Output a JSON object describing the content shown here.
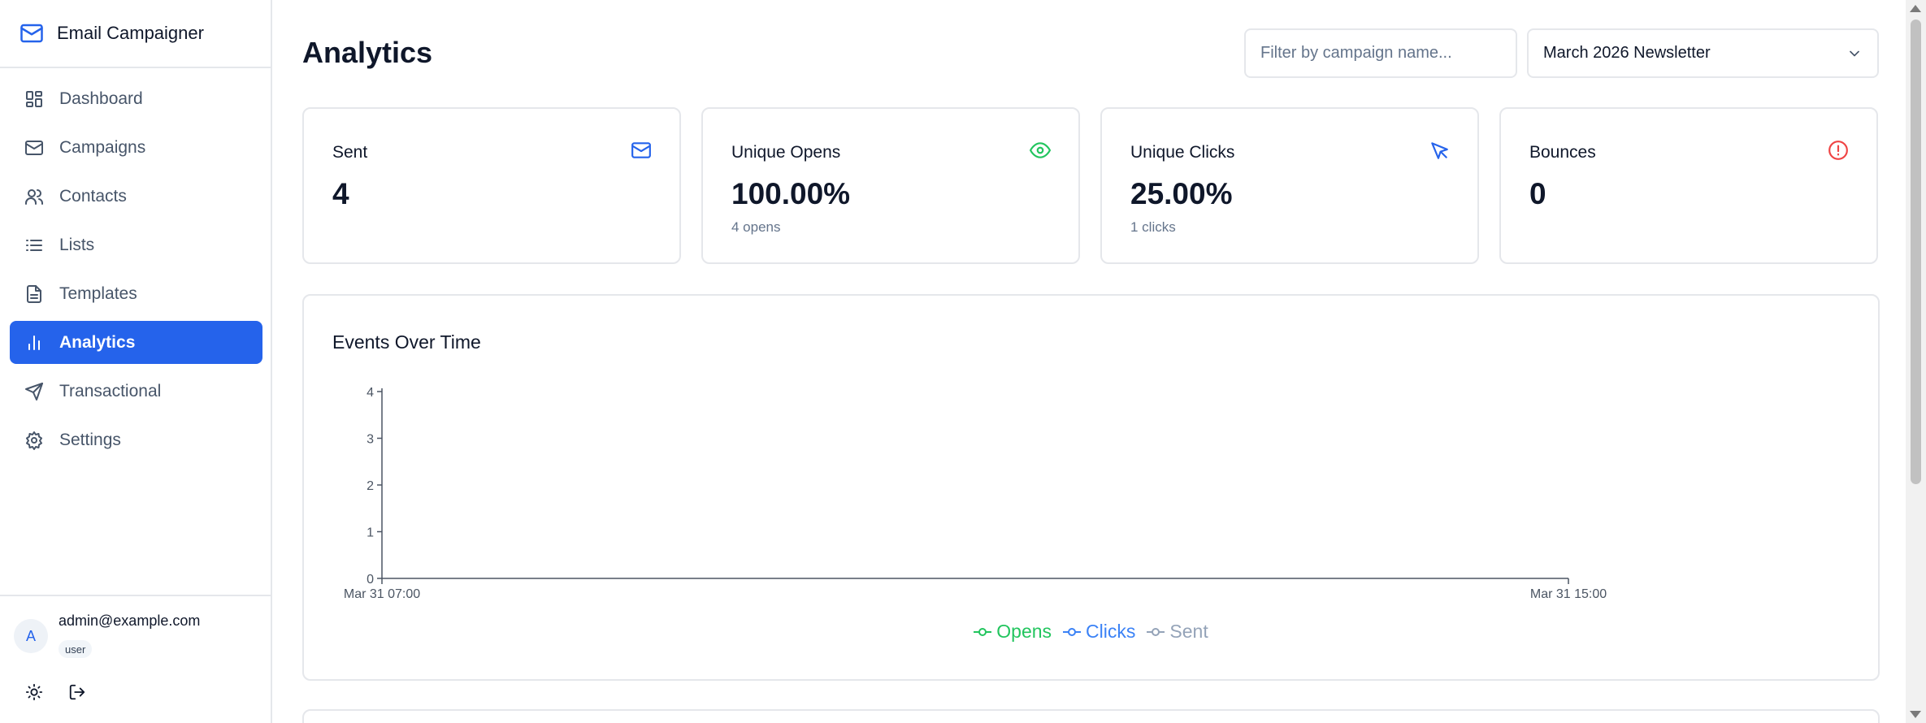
{
  "app": {
    "title": "Email Campaigner"
  },
  "sidebar": {
    "items": [
      {
        "label": "Dashboard",
        "icon": "dashboard-icon",
        "active": false
      },
      {
        "label": "Campaigns",
        "icon": "mail-icon",
        "active": false
      },
      {
        "label": "Contacts",
        "icon": "users-icon",
        "active": false
      },
      {
        "label": "Lists",
        "icon": "list-icon",
        "active": false
      },
      {
        "label": "Templates",
        "icon": "file-icon",
        "active": false
      },
      {
        "label": "Analytics",
        "icon": "bar-chart-icon",
        "active": true
      },
      {
        "label": "Transactional",
        "icon": "send-icon",
        "active": false
      },
      {
        "label": "Settings",
        "icon": "gear-icon",
        "active": false
      }
    ],
    "user": {
      "avatar_letter": "A",
      "email": "admin@example.com",
      "role": "user"
    }
  },
  "header": {
    "title": "Analytics",
    "filter_placeholder": "Filter by campaign name...",
    "filter_value": "",
    "selected_campaign": "March 2026 Newsletter"
  },
  "stats": [
    {
      "label": "Sent",
      "value": "4",
      "sub": "",
      "icon": "mail-icon",
      "color": "#2563eb"
    },
    {
      "label": "Unique Opens",
      "value": "100.00%",
      "sub": "4 opens",
      "icon": "eye-icon",
      "color": "#22c55e"
    },
    {
      "label": "Unique Clicks",
      "value": "25.00%",
      "sub": "1 clicks",
      "icon": "cursor-icon",
      "color": "#2563eb"
    },
    {
      "label": "Bounces",
      "value": "0",
      "sub": "",
      "icon": "alert-circle-icon",
      "color": "#ef4444"
    }
  ],
  "chart": {
    "title": "Events Over Time"
  },
  "chart_data": {
    "type": "line",
    "title": "Events Over Time",
    "x": [
      "Mar 31 07:00",
      "Mar 31 15:00"
    ],
    "yticks": [
      0,
      1,
      2,
      3,
      4
    ],
    "ylim": [
      0,
      4
    ],
    "series": [
      {
        "name": "Opens",
        "color": "#22c55e",
        "values": []
      },
      {
        "name": "Clicks",
        "color": "#3b82f6",
        "values": []
      },
      {
        "name": "Sent",
        "color": "#94a3b8",
        "values": []
      }
    ],
    "legend": "bottom",
    "grid": false
  }
}
